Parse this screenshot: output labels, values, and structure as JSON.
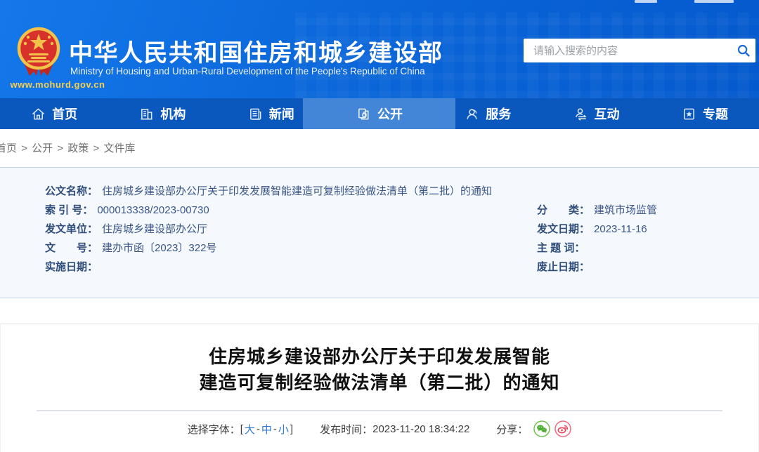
{
  "header": {
    "site_title": "中华人民共和国住房和城乡建设部",
    "site_subtitle": "Ministry of Housing and Urban-Rural Development of the People's Republic of China",
    "site_url": "www.mohurd.gov.cn",
    "search_placeholder": "请输入搜索的内容",
    "colors": {
      "header_blue": "#0b67da",
      "nav_blue": "#0a57bd",
      "nav_active_blue": "#4385d6",
      "search_icon_blue": "#1a6ad8",
      "emblem_gold": "#f2c24a",
      "emblem_red": "#d8302a",
      "url_gold": "#f7cf4e"
    }
  },
  "nav": {
    "items": [
      {
        "label": "首页",
        "icon": "home-icon",
        "active": false
      },
      {
        "label": "机构",
        "icon": "organization-icon",
        "active": false
      },
      {
        "label": "新闻",
        "icon": "news-icon",
        "active": false
      },
      {
        "label": "公开",
        "icon": "disclosure-icon",
        "active": true
      },
      {
        "label": "服务",
        "icon": "service-icon",
        "active": false
      },
      {
        "label": "互动",
        "icon": "interaction-icon",
        "active": false
      },
      {
        "label": "专题",
        "icon": "special-topic-icon",
        "active": false
      }
    ]
  },
  "breadcrumb": {
    "items": [
      "首页",
      "公开",
      "政策",
      "文件库"
    ],
    "separator": ">"
  },
  "doc_info": {
    "name_row": {
      "label": "公文名称：",
      "value": "住房城乡建设部办公厅关于印发发展智能建造可复制经验做法清单（第二批）的通知"
    },
    "left": [
      {
        "label": "索 引 号：",
        "value": "000013338/2023-00730"
      },
      {
        "label": "发文单位：",
        "value": "住房城乡建设部办公厅"
      },
      {
        "label": "文　　号：",
        "value": "建办市函〔2023〕322号"
      },
      {
        "label": "实施日期：",
        "value": ""
      }
    ],
    "right": [
      {
        "label": "分　　类：",
        "value": "建筑市场监管"
      },
      {
        "label": "发文日期：",
        "value": "2023-11-16"
      },
      {
        "label": "主 题 词：",
        "value": ""
      },
      {
        "label": "废止日期：",
        "value": ""
      }
    ]
  },
  "article": {
    "title_line1": "住房城乡建设部办公厅关于印发发展智能",
    "title_line2": "建造可复制经验做法清单（第二批）的通知",
    "font_selector": {
      "label": "选择字体：",
      "open": "[",
      "large": "大",
      "sep1": "-",
      "medium": "中",
      "sep2": "-",
      "small": "小",
      "close": "]"
    },
    "publish": {
      "label": "发布时间：",
      "time": "2023-11-20 18:34:22"
    },
    "share": {
      "label": "分享：",
      "icons": [
        "wechat-icon",
        "weibo-icon"
      ],
      "wechat_green": "#4fae33",
      "weibo_red": "#e6475c"
    }
  }
}
